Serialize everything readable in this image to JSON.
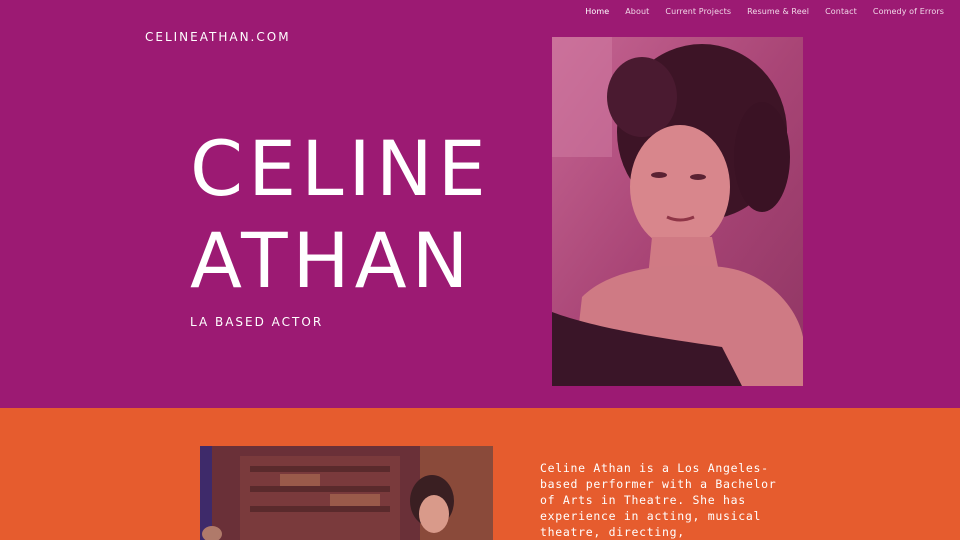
{
  "nav": {
    "items": [
      {
        "label": "Home",
        "active": true
      },
      {
        "label": "About"
      },
      {
        "label": "Current Projects"
      },
      {
        "label": "Resume & Reel"
      },
      {
        "label": "Contact"
      },
      {
        "label": "Comedy of Errors"
      }
    ]
  },
  "site": {
    "logo": "CELINEATHAN.COM"
  },
  "hero": {
    "name_line_1": "CELINE",
    "name_line_2": "ATHAN",
    "tagline": "LA BASED ACTOR"
  },
  "about": {
    "bio": "Celine Athan is a Los Angeles-based performer with a Bachelor of Arts in Theatre. She has experience in acting, musical theatre, directing,"
  },
  "colors": {
    "hero_background": "#9c1a73",
    "about_background": "#e65c2e",
    "text": "#ffffff"
  }
}
